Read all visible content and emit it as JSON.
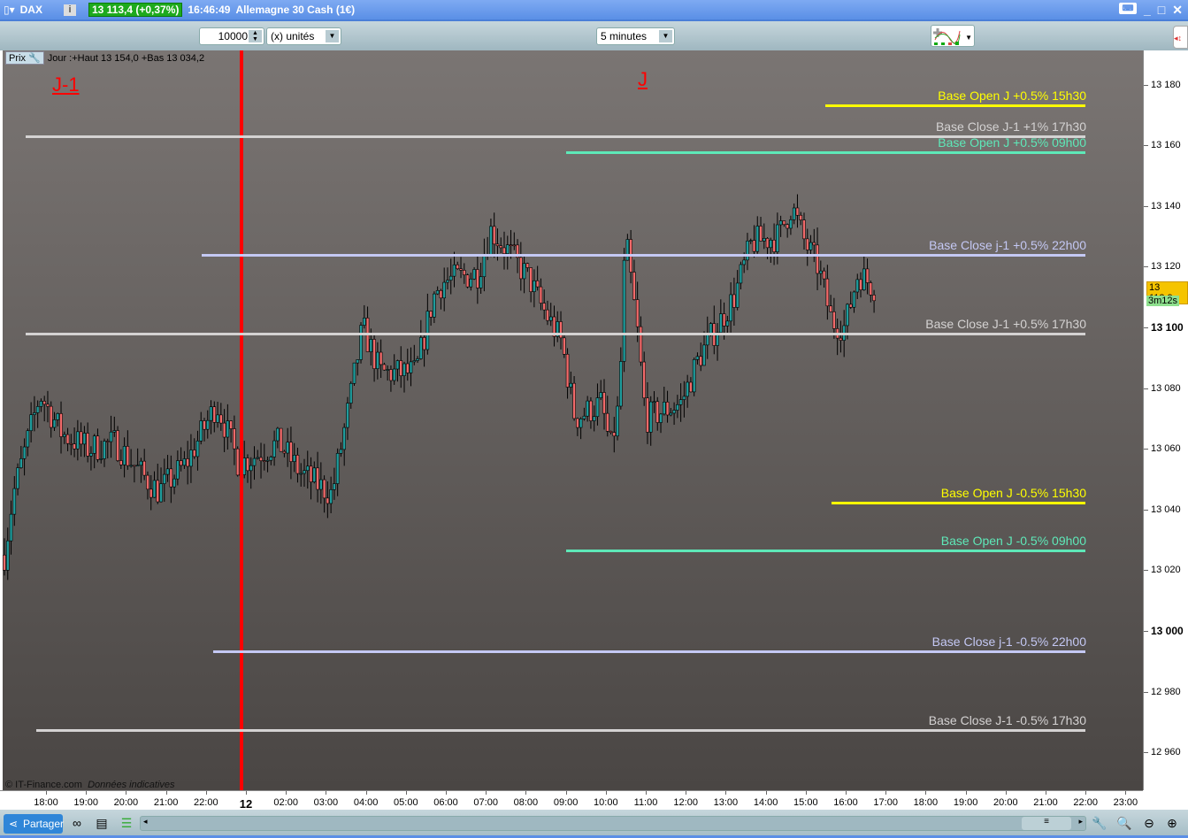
{
  "titlebar": {
    "symbol": "DAX",
    "quote": "13 113,4 (+0,37%)",
    "time": "16:46:49",
    "instrument": "Allemagne 30 Cash (1€)",
    "info_label": "i",
    "keyboard_label": "⌨"
  },
  "toolbar": {
    "quantity": "10000",
    "unit": "(x) unités",
    "interval": "5 minutes"
  },
  "chart": {
    "info_tab": "Prix",
    "info_text": "Jour :+Haut 13 154,0 +Bas 13 034,2",
    "day_prev": "J-1",
    "day_cur": "J",
    "copyright": "© IT-Finance.com",
    "disclaimer": "Données indicatives",
    "current_price": "13 112,9",
    "countdown": "3m12s",
    "colors": {
      "up": "#1f9c9c",
      "down": "#f26a6a",
      "divider": "#ff0000"
    }
  },
  "price_axis": [
    "13 180",
    "13 160",
    "13 140",
    "13 120",
    "13 100",
    "13 080",
    "13 060",
    "13 040",
    "13 020",
    "13 000",
    "12 980",
    "12 960"
  ],
  "time_axis": [
    "18:00",
    "19:00",
    "20:00",
    "21:00",
    "22:00",
    "12",
    "02:00",
    "03:00",
    "04:00",
    "05:00",
    "06:00",
    "07:00",
    "08:00",
    "09:00",
    "10:00",
    "11:00",
    "12:00",
    "13:00",
    "14:00",
    "15:00",
    "16:00",
    "17:00",
    "18:00",
    "19:00",
    "20:00",
    "21:00",
    "22:00",
    "23:00"
  ],
  "levels": [
    {
      "label": "Base Open J +0.5% 15h30",
      "price": 13173.2,
      "start": 19.5,
      "color": "#ffff00"
    },
    {
      "label": "Base Close J-1 +1% 17h30",
      "price": 13163,
      "start": -0.5,
      "color": "#d4d2d2"
    },
    {
      "label": "Base Open J +0.5% 09h00",
      "price": 13157.7,
      "start": 13.0,
      "color": "#5ee8b8"
    },
    {
      "label": "Base Close j-1 +0.5% 22h00",
      "price": 13123.9,
      "start": 3.9,
      "color": "#c4c8f4"
    },
    {
      "label": "Base Close J-1 +0.5% 17h30",
      "price": 13098,
      "start": -0.5,
      "color": "#d4d2d2"
    },
    {
      "label": "Base Open J -0.5% 15h30",
      "price": 13042.3,
      "start": 19.65,
      "color": "#ffff00"
    },
    {
      "label": "Base Open J -0.5% 09h00",
      "price": 13026.5,
      "start": 13.0,
      "color": "#5ee8b8"
    },
    {
      "label": "Base Close j-1 -0.5% 22h00",
      "price": 12993.3,
      "start": 4.18,
      "color": "#c4c8f4"
    },
    {
      "label": "Base Close J-1 -0.5% 17h30",
      "price": 12967.3,
      "start": -0.25,
      "color": "#d4d2d2"
    }
  ],
  "chart_data": {
    "type": "candlestick",
    "interval": "5 minutes",
    "ylim": [
      12945,
      13190
    ],
    "path": [
      [
        -1.04,
        13025
      ],
      [
        -0.82,
        13045
      ],
      [
        -0.15,
        13078
      ],
      [
        0.4,
        13065
      ],
      [
        1.06,
        13060
      ],
      [
        1.73,
        13062
      ],
      [
        2.5,
        13050
      ],
      [
        2.83,
        13046
      ],
      [
        3.5,
        13055
      ],
      [
        4.27,
        13075
      ],
      [
        4.82,
        13055
      ],
      [
        5.27,
        13058
      ],
      [
        5.82,
        13062
      ],
      [
        6.37,
        13052
      ],
      [
        7.15,
        13045
      ],
      [
        7.59,
        13075
      ],
      [
        7.92,
        13100
      ],
      [
        8.36,
        13085
      ],
      [
        9.25,
        13085
      ],
      [
        9.69,
        13110
      ],
      [
        9.91,
        13115
      ],
      [
        10.8,
        13118
      ],
      [
        11.13,
        13132
      ],
      [
        11.57,
        13125
      ],
      [
        12.12,
        13115
      ],
      [
        12.35,
        13108
      ],
      [
        12.9,
        13095
      ],
      [
        13.23,
        13070
      ],
      [
        13.89,
        13075
      ],
      [
        14.12,
        13060
      ],
      [
        14.34,
        13075
      ],
      [
        14.49,
        13130
      ],
      [
        14.78,
        13100
      ],
      [
        15.0,
        13070
      ],
      [
        15.88,
        13075
      ],
      [
        16.33,
        13090
      ],
      [
        16.77,
        13100
      ],
      [
        17.21,
        13110
      ],
      [
        17.65,
        13128
      ],
      [
        18.32,
        13130
      ],
      [
        18.65,
        13140
      ],
      [
        18.98,
        13128
      ],
      [
        19.31,
        13120
      ],
      [
        19.65,
        13102
      ],
      [
        19.98,
        13100
      ],
      [
        20.31,
        13118
      ],
      [
        20.75,
        13112.9
      ]
    ]
  },
  "bottombar": {
    "share_label": "Partager"
  }
}
